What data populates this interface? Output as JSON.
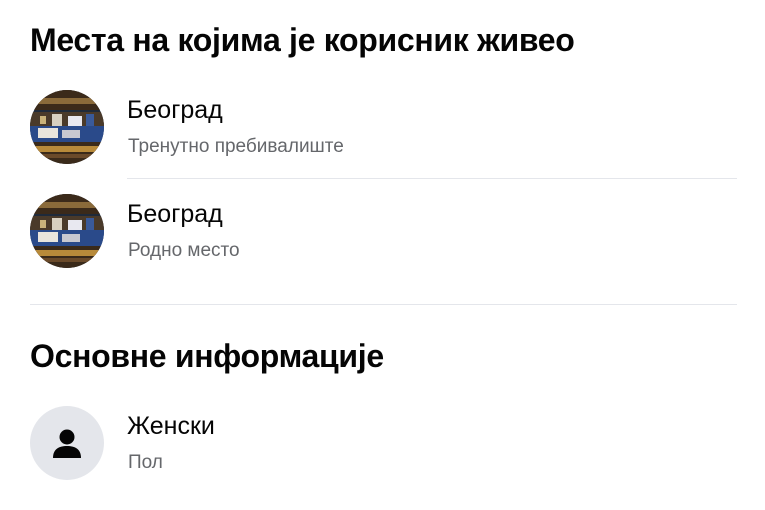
{
  "places_section": {
    "title": "Места на којима је корисник живео",
    "items": [
      {
        "name": "Београд",
        "subtitle": "Тренутно пребивалиште",
        "icon": "city-photo-icon"
      },
      {
        "name": "Београд",
        "subtitle": "Родно место",
        "icon": "city-photo-icon"
      }
    ]
  },
  "basic_section": {
    "title": "Основне информације",
    "items": [
      {
        "value": "Женски",
        "subtitle": "Пол",
        "icon": "person-icon"
      }
    ]
  },
  "colors": {
    "text": "#050505",
    "secondary_text": "#65676b",
    "divider": "#e4e6eb",
    "icon_background": "#e4e6eb"
  }
}
